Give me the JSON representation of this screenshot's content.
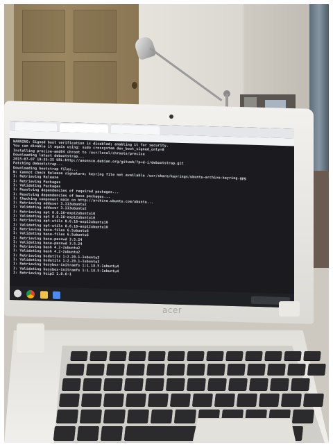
{
  "scene": {
    "laptop_brand": "acer"
  },
  "terminal": {
    "lines": [
      "WARNING: Signed boot verification is disabled; enabling it for security.",
      "You can disable it again using: sudo crossystem dev_boot_signed_only=0",
      "Installing precise-amd64 chroot to /usr/local/chroots/precise",
      "Downloading latest debootstrap...",
      "2015-07-07 19:35:35 URL:http://anonscm.debian.org/gitweb/?p=d-i/debootstrap.git",
      "Patching debootstrap...",
      "Downloading bootstrap files...",
      "W: Cannot check Release signature; keyring file not available /usr/share/keyrings/ubuntu-archive-keyring.gpg",
      "I: Retrieving Release",
      "I: Retrieving Packages",
      "I: Validating Packages",
      "I: Resolving dependencies of required packages...",
      "I: Resolving dependencies of base packages...",
      "I: Checking component main on http://archive.ubuntu.com/ubuntu...",
      "I: Retrieving adduser 3.113ubuntu2",
      "I: Validating adduser 3.113ubuntu2",
      "I: Retrieving apt 0.8.16~exp12ubuntu10",
      "I: Validating apt 0.8.16~exp12ubuntu10",
      "I: Retrieving apt-utils 0.8.16~exp12ubuntu10",
      "I: Validating apt-utils 0.8.16~exp12ubuntu10",
      "I: Retrieving base-files 6.5ubuntu6",
      "I: Validating base-files 6.5ubuntu6",
      "I: Retrieving base-passwd 3.5.24",
      "I: Validating base-passwd 3.5.24",
      "I: Retrieving bash 4.2-2ubuntu2",
      "I: Validating bash 4.2-2ubuntu2",
      "I: Retrieving bsdutils 1:2.20.1-1ubuntu3",
      "I: Validating bsdutils 1:2.20.1-1ubuntu3",
      "I: Retrieving busybox-initramfs 1:1.18.5-1ubuntu4",
      "I: Validating busybox-initramfs 1:1.18.5-1ubuntu4",
      "I: Retrieving bzip2 1.0.6-1"
    ]
  },
  "colors": {
    "terminal_bg": "#1b1b1f",
    "terminal_text": "#d8dde3",
    "laptop_shell": "#f0efec",
    "keys": "#2b2b2e"
  }
}
